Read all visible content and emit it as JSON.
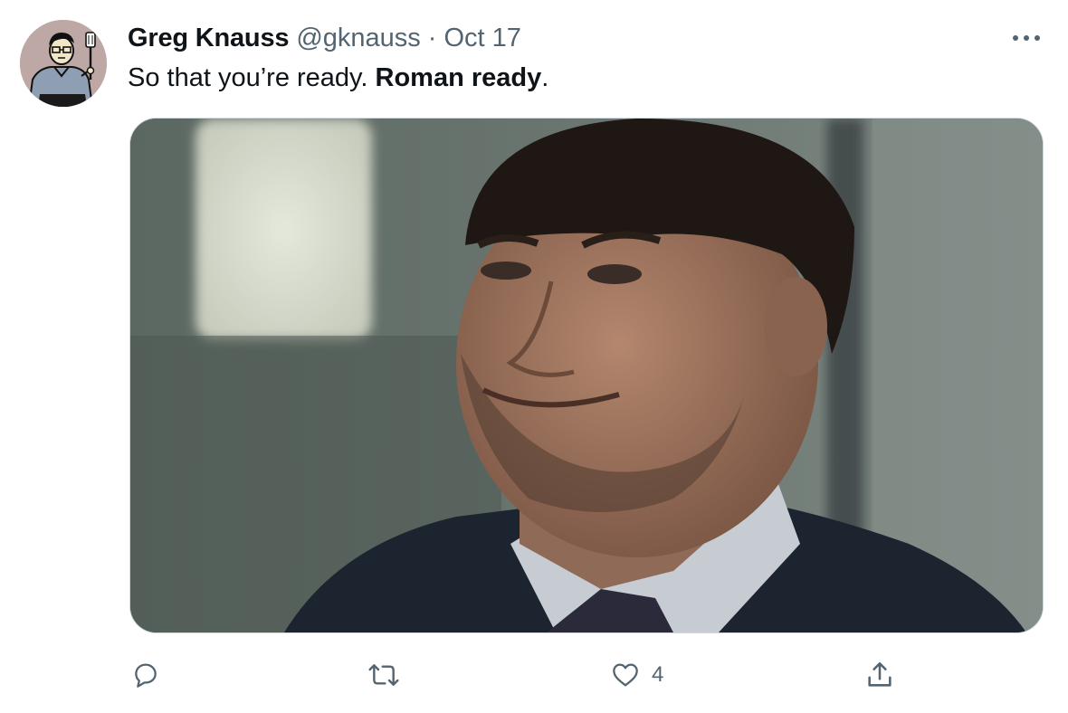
{
  "author": {
    "name": "Greg Knauss",
    "handle": "@gknauss",
    "separator": "·",
    "date": "Oct 17",
    "avatar_icon": "cartoon-man-with-spatula-avatar"
  },
  "tweet": {
    "text_plain": "So that you’re ready.",
    "text_bold": "Roman ready",
    "text_end": "."
  },
  "media": {
    "alt_kind": "photo of smiling man in suit and tie"
  },
  "actions": {
    "reply": {
      "icon": "reply-icon"
    },
    "retweet": {
      "icon": "retweet-icon"
    },
    "like": {
      "icon": "heart-icon",
      "count": "4"
    },
    "share": {
      "icon": "share-icon"
    }
  },
  "colors": {
    "text_primary": "#0f1419",
    "text_secondary": "#536471",
    "border": "#cfd9de"
  }
}
